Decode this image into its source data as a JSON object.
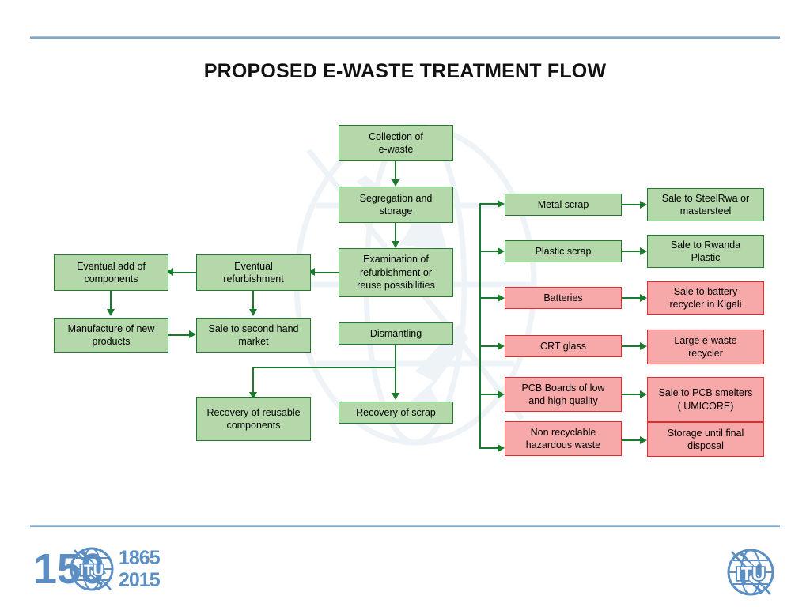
{
  "slide": {
    "title": "PROPOSED E-WASTE TREATMENT FLOW",
    "accent_rule_color": "#7fa7c9",
    "green_fill": "#b5d8ab",
    "green_border": "#1f7a30",
    "red_fill": "#f7a9a9",
    "red_border": "#e02b2b",
    "connector_color": "#1a7a2e"
  },
  "main_flow": {
    "collection": {
      "line1": "Collection of",
      "line2": "e-waste"
    },
    "segregation": {
      "line1": "Segregation and",
      "line2": "storage"
    },
    "examination": {
      "line1": "Examination of",
      "line2": "refurbishment or",
      "line3": "reuse possibilities"
    },
    "dismantling": {
      "line1": "Dismantling"
    },
    "recovery_scrap": {
      "line1": "Recovery of scrap"
    }
  },
  "reuse_branch": {
    "refurbishment": {
      "line1": "Eventual",
      "line2": "refurbishment"
    },
    "add_components": {
      "line1": "Eventual add of",
      "line2": "components"
    },
    "manufacture": {
      "line1": "Manufacture of new",
      "line2": "products"
    },
    "second_hand": {
      "line1": "Sale to second hand",
      "line2": "market"
    },
    "reusable": {
      "line1": "Recovery of reusable",
      "line2": "components"
    }
  },
  "fractions": [
    {
      "id": "metal-scrap",
      "label1": "Metal scrap",
      "label2": "",
      "color": "green"
    },
    {
      "id": "plastic-scrap",
      "label1": "Plastic scrap",
      "label2": "",
      "color": "green"
    },
    {
      "id": "batteries",
      "label1": "Batteries",
      "label2": "",
      "color": "red"
    },
    {
      "id": "crt-glass",
      "label1": "CRT glass",
      "label2": "",
      "color": "red"
    },
    {
      "id": "pcb-boards",
      "label1": "PCB Boards of low",
      "label2": "and high quality",
      "color": "red"
    },
    {
      "id": "hazardous",
      "label1": "Non recyclable",
      "label2": "hazardous waste",
      "color": "red"
    }
  ],
  "destinations": [
    {
      "id": "steelrwa",
      "label1": "Sale to SteelRwa or",
      "label2": "mastersteel",
      "color": "green"
    },
    {
      "id": "rwanda-plastic",
      "label1": "Sale to Rwanda",
      "label2": "Plastic",
      "color": "green"
    },
    {
      "id": "battery-recycler",
      "label1": "Sale to battery",
      "label2": "recycler in Kigali",
      "color": "red"
    },
    {
      "id": "large-ewaste",
      "label1": "Large e-waste",
      "label2": "recycler",
      "color": "red"
    },
    {
      "id": "pcb-smelters",
      "label1": "Sale to PCB smelters",
      "label2": "( UMICORE)",
      "color": "red"
    },
    {
      "id": "storage-final",
      "label1": "Storage until  final",
      "label2": "disposal",
      "color": "red"
    }
  ],
  "logos": {
    "anniversary": {
      "number": "150",
      "itu": "ITU",
      "year_from": "1865",
      "year_to": "2015",
      "color": "#5b8fc4"
    },
    "itu_mark": {
      "text": "ITU",
      "color": "#5b8fc4"
    }
  }
}
